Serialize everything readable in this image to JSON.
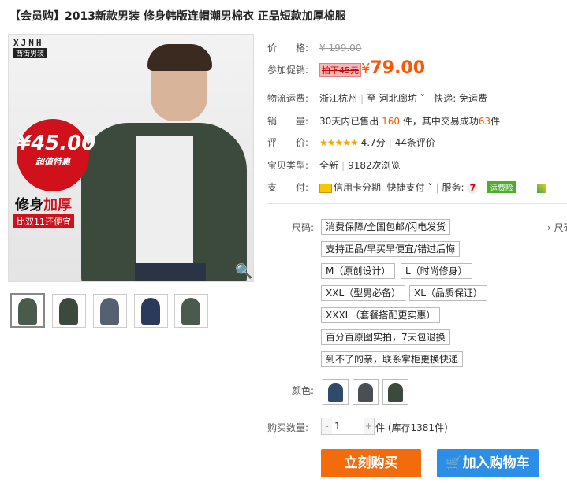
{
  "title": "【会员购】2013新款男装 修身韩版连帽潮男棉衣 正品短款加厚棉服",
  "image": {
    "brand_en": "XJNH",
    "brand_cn": "西街男装",
    "badge_price": "¥45.00",
    "badge_sub": "超值特惠",
    "promo_line1a": "修身",
    "promo_line1b": "加厚",
    "promo_line2": "比双11还便宜"
  },
  "thumbnails": [
    {
      "color": "#4a5a4c"
    },
    {
      "color": "#3c4a3e"
    },
    {
      "color": "#556070"
    },
    {
      "color": "#2b3a5a"
    },
    {
      "color": "#4a5a4c"
    }
  ],
  "info": {
    "price_label": "价　　格:",
    "price_value": "¥ 199.00",
    "promo_label": "参加促销:",
    "promo_tag": "拍下45元",
    "promo_currency": "¥",
    "promo_price": "79.00",
    "shipping_label": "物流运费:",
    "shipping_from": "浙江杭州",
    "shipping_sep": "至",
    "shipping_to": "河北廊坊",
    "shipping_method": "快递: 免运费",
    "sales_label": "销　　量:",
    "sales_pre": "30天内已售出",
    "sales_count": "160",
    "sales_mid": "件，其中交易成功",
    "sales_success": "63",
    "sales_suffix": "件",
    "rating_label": "评　　价:",
    "rating_stars": "★★★★★",
    "rating_value": "4.7分",
    "rating_count": "44条评价",
    "type_label": "宝贝类型:",
    "type_value": "全新",
    "views": "9182次浏览",
    "pay_label": "支　　付:",
    "pay_credit": "信用卡分期",
    "pay_quick": "快捷支付",
    "service_label": "服务:",
    "service_7": "7",
    "service_ins": "运费险"
  },
  "options": {
    "size_label": "尺码:",
    "size_extra": "› 尺码",
    "sizes": [
      "消费保障/全国包邮/闪电发货",
      "支持正品/早买早便宜/错过后悔",
      "M（原创设计）",
      "L（时尚修身）",
      "XXL（型男必备）",
      "XL（品质保证）",
      "XXXL（套餐搭配更实惠）",
      "百分百原图实拍，7天包退换",
      "到不了的亲，联系掌柜更换快递"
    ],
    "color_label": "颜色:",
    "colors": [
      "#2f4a6a",
      "#4a4f54",
      "#3c4a3e"
    ],
    "qty_label": "购买数量:",
    "qty_minus": "-",
    "qty_value": "1",
    "qty_plus": "+",
    "qty_unit": "件",
    "stock": "(库存1381件)",
    "buy_now": "立刻购买",
    "add_cart": "🛒加入购物车"
  }
}
